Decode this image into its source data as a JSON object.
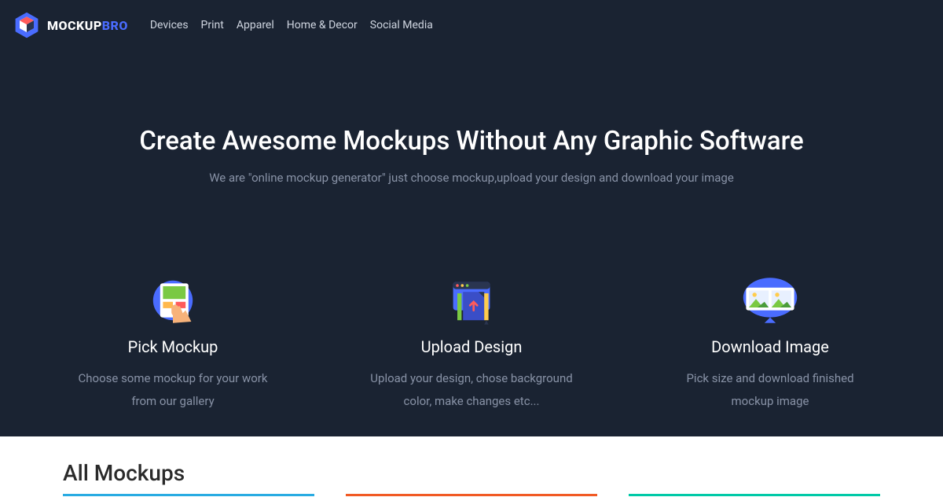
{
  "brand": {
    "name_a": "MOCKUP",
    "name_b": "BRO"
  },
  "nav": [
    {
      "label": "Devices"
    },
    {
      "label": "Print"
    },
    {
      "label": "Apparel"
    },
    {
      "label": "Home & Decor"
    },
    {
      "label": "Social Media"
    }
  ],
  "hero": {
    "title": "Create Awesome Mockups Without Any Graphic Software",
    "subtitle": "We are \"online mockup generator\" just choose mockup,upload your design and download your image"
  },
  "steps": [
    {
      "title": "Pick Mockup",
      "desc": "Choose some mockup for your work from our gallery"
    },
    {
      "title": "Upload Design",
      "desc": "Upload your design, chose background color, make changes etc..."
    },
    {
      "title": "Download Image",
      "desc": "Pick size and download finished mockup image"
    }
  ],
  "section": {
    "title": "All Mockups"
  }
}
